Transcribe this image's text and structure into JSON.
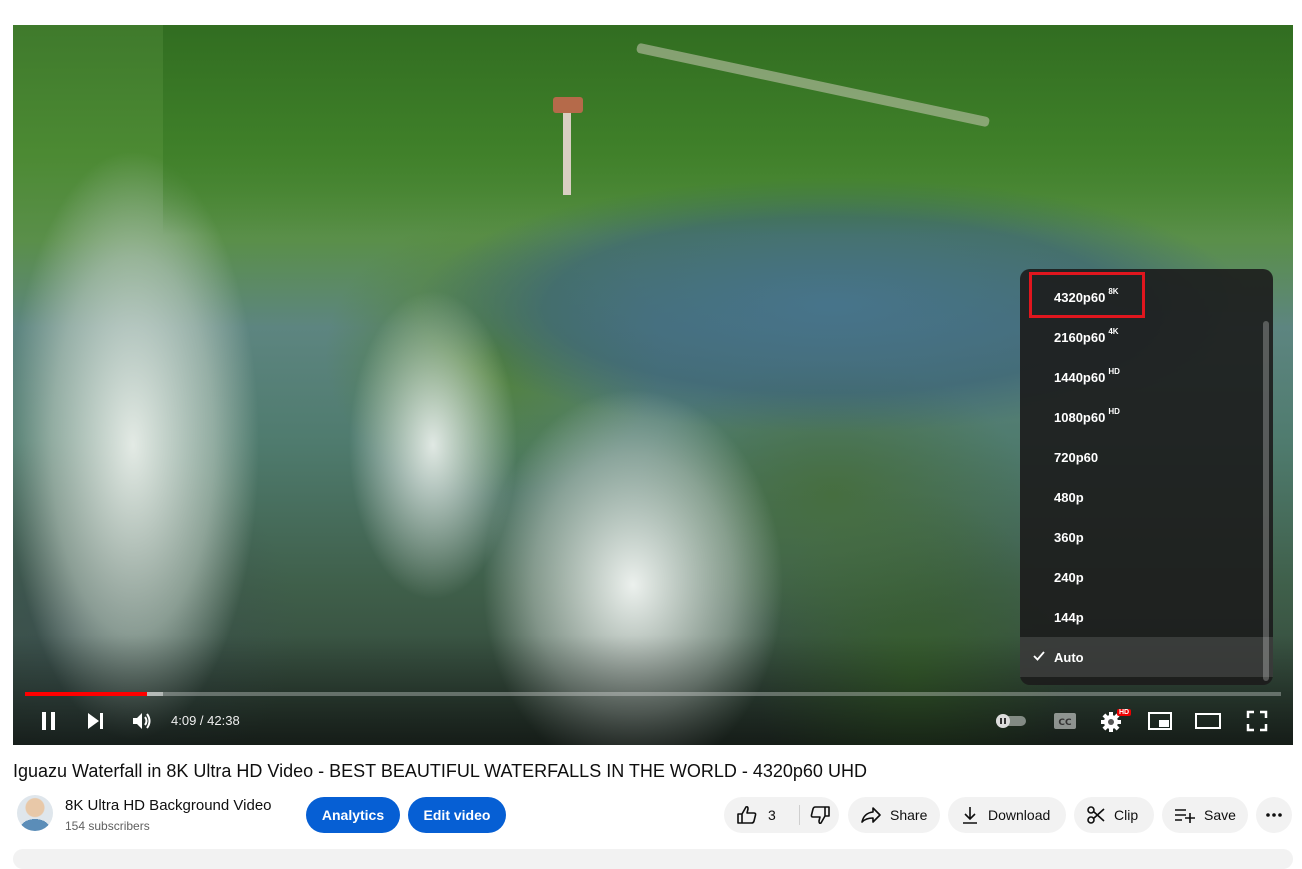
{
  "player": {
    "time_current": "4:09",
    "time_separator": " / ",
    "time_total": "42:38",
    "progress_played": 0.097,
    "progress_loaded": 0.11,
    "settings_badge": "HD",
    "quality_menu": {
      "items": [
        {
          "label": "4320p60",
          "badge": "8K"
        },
        {
          "label": "2160p60",
          "badge": "4K"
        },
        {
          "label": "1440p60",
          "badge": "HD"
        },
        {
          "label": "1080p60",
          "badge": "HD"
        },
        {
          "label": "720p60",
          "badge": ""
        },
        {
          "label": "480p",
          "badge": ""
        },
        {
          "label": "360p",
          "badge": ""
        },
        {
          "label": "240p",
          "badge": ""
        },
        {
          "label": "144p",
          "badge": ""
        },
        {
          "label": "Auto",
          "badge": "",
          "selected": true
        }
      ]
    },
    "icons": [
      "pause-icon",
      "next-icon",
      "volume-icon",
      "autoplay-toggle-icon",
      "cc-icon",
      "gear-icon",
      "miniplayer-icon",
      "theater-icon",
      "fullscreen-icon"
    ]
  },
  "video": {
    "title": "Iguazu Waterfall in 8K Ultra HD Video - BEST BEAUTIFUL WATERFALLS IN THE WORLD - 4320p60 UHD"
  },
  "channel": {
    "name": "8K Ultra HD Background Video",
    "subscribers": "154 subscribers"
  },
  "actions": {
    "analytics_label": "Analytics",
    "edit_label": "Edit video",
    "like_count": "3",
    "share_label": "Share",
    "download_label": "Download",
    "clip_label": "Clip",
    "save_label": "Save"
  },
  "colors": {
    "accent_blue": "#065fd4",
    "progress_red": "#ff0000",
    "highlight_red": "#e0161e",
    "pill_bg": "#f2f2f2"
  }
}
